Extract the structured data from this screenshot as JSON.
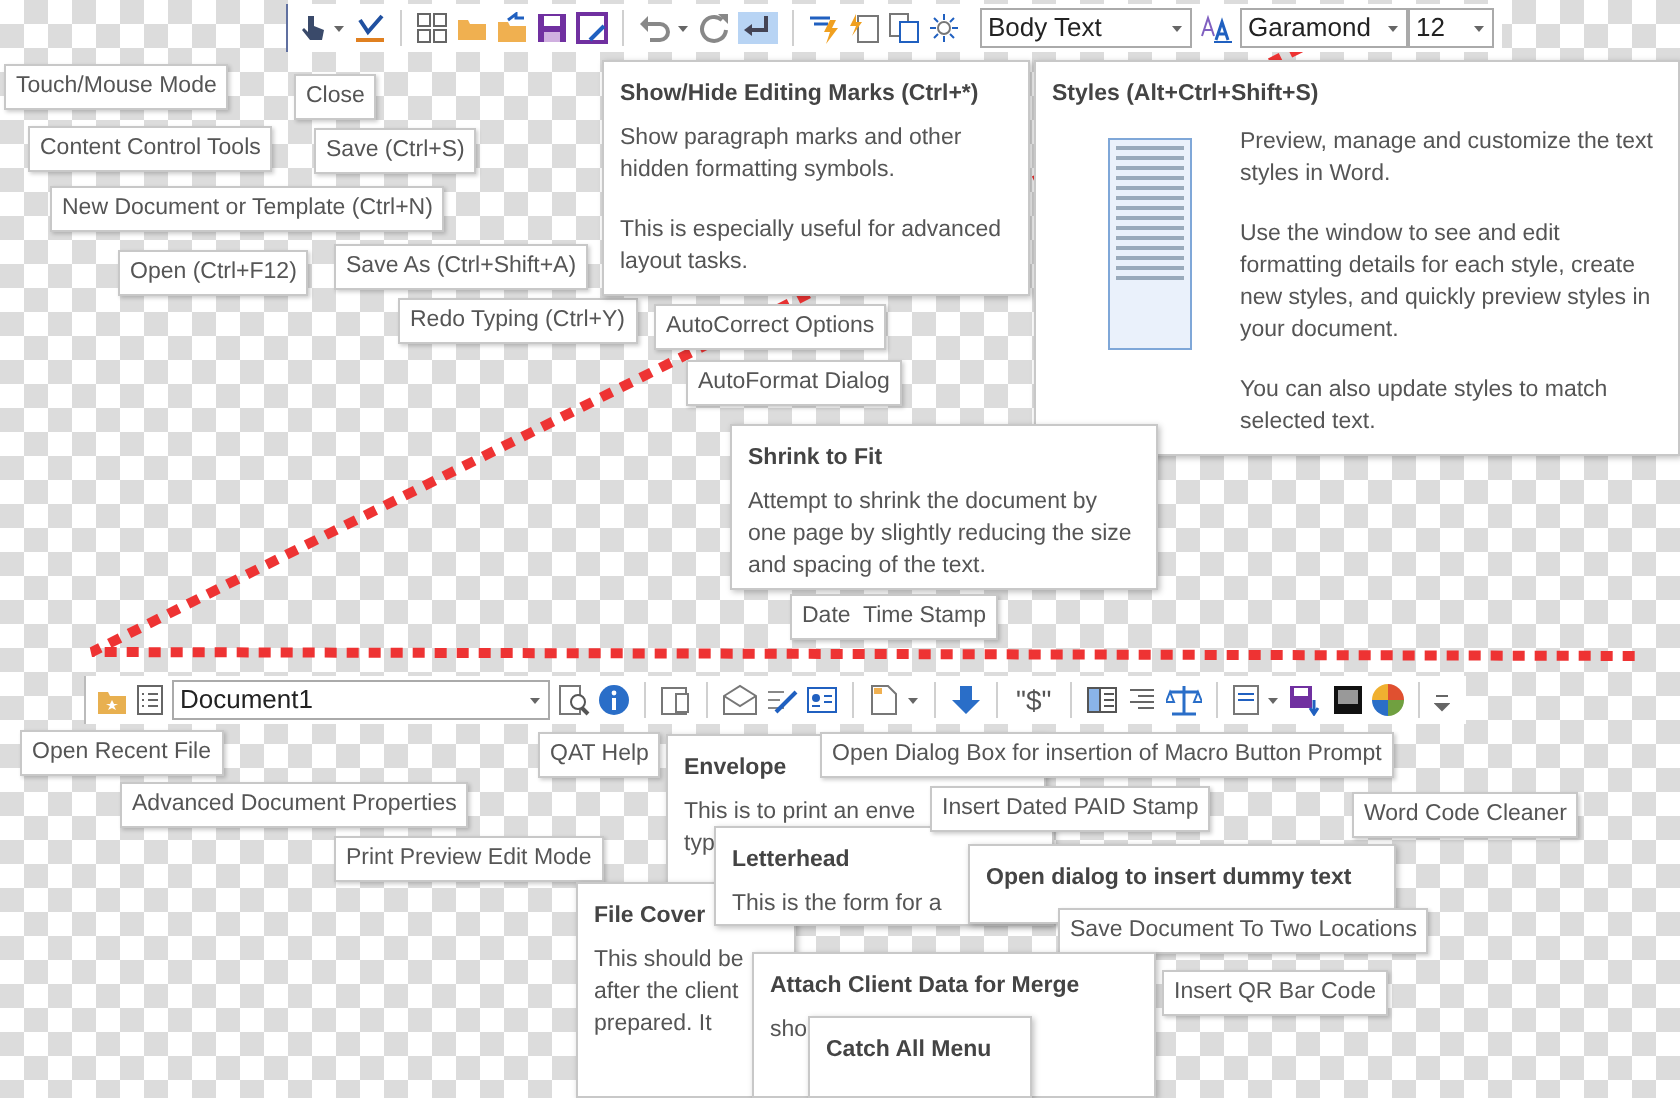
{
  "top_toolbar": {
    "formatting_marks_pressed": true,
    "style": "Body Text",
    "font": "Garamond",
    "size": "12"
  },
  "top_tooltips": [
    {
      "kind": "simple",
      "text": "Touch/Mouse Mode"
    },
    {
      "kind": "simple",
      "text": "Close"
    },
    {
      "kind": "simple",
      "text": "Content Control Tools"
    },
    {
      "kind": "simple",
      "text": "Save (Ctrl+S)"
    },
    {
      "kind": "simple",
      "text": "New Document or Template (Ctrl+N)"
    },
    {
      "kind": "simple",
      "text": "Open (Ctrl+F12)"
    },
    {
      "kind": "simple",
      "text": "Save As (Ctrl+Shift+A)"
    },
    {
      "kind": "simple",
      "text": "Redo Typing (Ctrl+Y)"
    },
    {
      "kind": "rich",
      "title": "Show/Hide Editing Marks (Ctrl+*)",
      "paragraphs": [
        "Show paragraph marks and other hidden formatting symbols.",
        "This is especially useful for advanced layout tasks."
      ]
    },
    {
      "kind": "simple",
      "text": "AutoCorrect Options"
    },
    {
      "kind": "simple",
      "text": "AutoFormat Dialog"
    },
    {
      "kind": "styles",
      "title": "Styles (Alt+Ctrl+Shift+S)",
      "paragraphs": [
        "Preview, manage and customize the text styles in Word.",
        "Use the window to see and edit formatting details for each style, create new styles, and quickly preview styles in your document.",
        "You can also update styles to match selected text."
      ]
    },
    {
      "kind": "rich",
      "title": "Shrink to Fit",
      "paragraphs": [
        "Attempt to shrink the document by one page by slightly reducing the size and spacing of the text."
      ]
    },
    {
      "kind": "simple",
      "text": "Date  Time Stamp"
    }
  ],
  "bottom_toolbar": {
    "document": "Document1",
    "macro_label": "\"$\""
  },
  "bottom_tooltips": [
    {
      "kind": "simple",
      "text": "Open Recent File"
    },
    {
      "kind": "simple",
      "text": "Advanced Document Properties"
    },
    {
      "kind": "simple",
      "text": "Print Preview Edit Mode"
    },
    {
      "kind": "simple",
      "text": "QAT Help"
    },
    {
      "kind": "fragment",
      "title": "Envelope",
      "paragraphs": [
        "This is to print an enve",
        "typ"
      ]
    },
    {
      "kind": "fragment",
      "title": "File Cover",
      "paragraphs": [
        "This should be",
        "after the client",
        "prepared. It"
      ]
    },
    {
      "kind": "fragment",
      "title": "Letterhead",
      "paragraphs": [
        "This is the form for a"
      ]
    },
    {
      "kind": "simple",
      "text": "Open Dialog Box for insertion of Macro Button Prompt"
    },
    {
      "kind": "simple",
      "text": "Insert Dated PAID Stamp"
    },
    {
      "kind": "fragment",
      "title": "Open dialog to insert dummy text"
    },
    {
      "kind": "simple",
      "text": "Save Document To Two Locations"
    },
    {
      "kind": "fragment",
      "title": "Attach Client Data for Merge",
      "paragraphs": [
        "sho"
      ]
    },
    {
      "kind": "simple",
      "text": "Insert QR Bar Code"
    },
    {
      "kind": "fragment",
      "title": "Catch All Menu"
    },
    {
      "kind": "simple",
      "text": "Word Code Cleaner"
    }
  ]
}
